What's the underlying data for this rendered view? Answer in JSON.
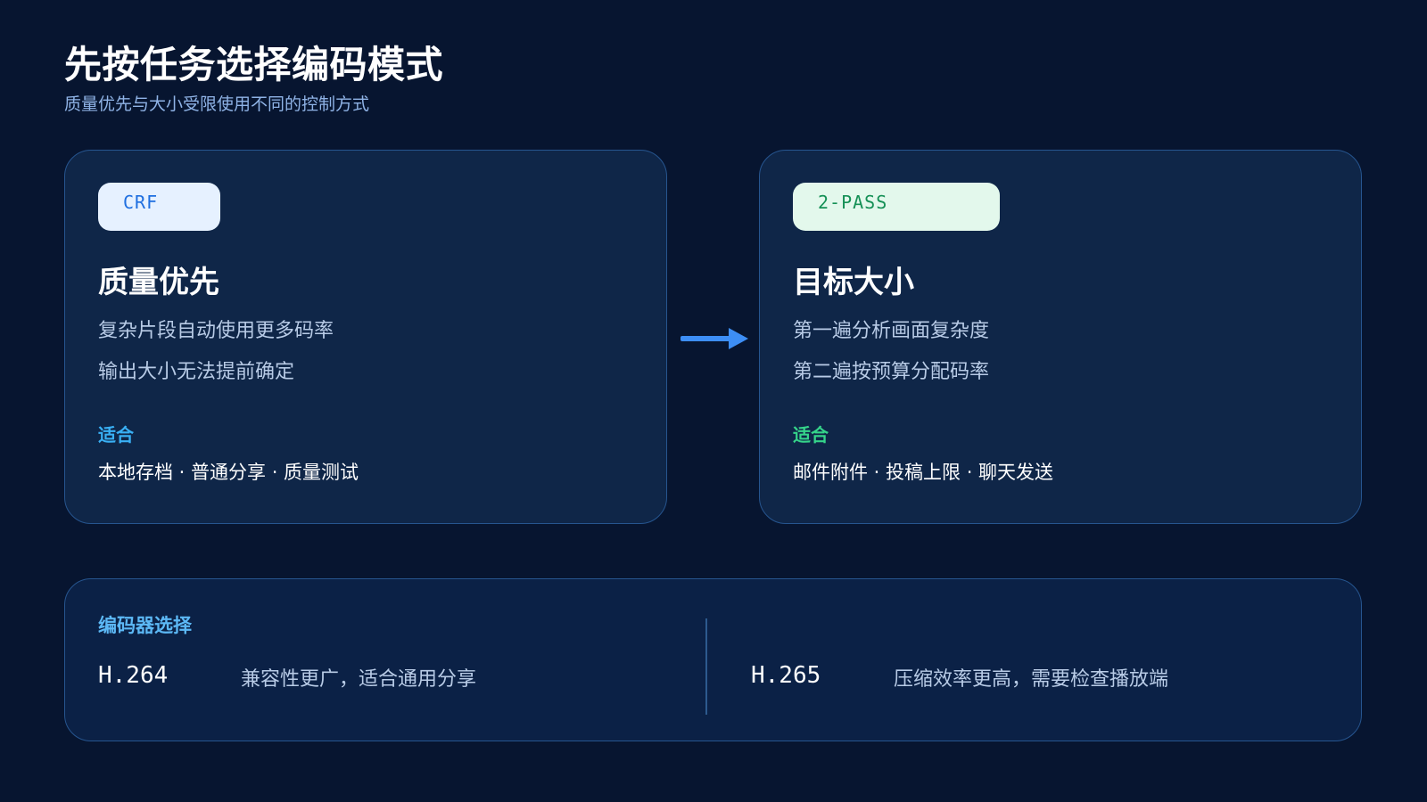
{
  "page": {
    "title": "先按任务选择编码模式",
    "subtitle": "质量优先与大小受限使用不同的控制方式"
  },
  "cards": [
    {
      "badge": "CRF",
      "title": "质量优先",
      "lines": [
        "复杂片段自动使用更多码率",
        "输出大小无法提前确定"
      ],
      "fit_label": "适合",
      "fit_text": "本地存档 · 普通分享 · 质量测试"
    },
    {
      "badge": "2-PASS",
      "title": "目标大小",
      "lines": [
        "第一遍分析画面复杂度",
        "第二遍按预算分配码率"
      ],
      "fit_label": "适合",
      "fit_text": "邮件附件 · 投稿上限 · 聊天发送"
    }
  ],
  "encoder_panel": {
    "title": "编码器选择",
    "codecs": [
      {
        "name": "H.264",
        "desc": "兼容性更广，适合通用分享"
      },
      {
        "name": "H.265",
        "desc": "压缩效率更高，需要检查播放端"
      }
    ]
  },
  "colors": {
    "background": "#071530",
    "card": "#0f2648",
    "border": "#26558f",
    "accent_blue": "#39b0f5",
    "accent_green": "#35d48a",
    "arrow": "#3d8ef5"
  },
  "icons": {
    "arrow": "arrow-right-icon"
  }
}
